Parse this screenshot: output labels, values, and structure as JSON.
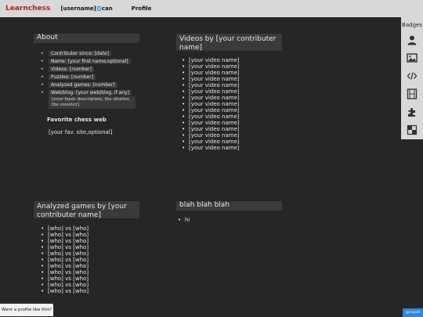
{
  "nav": {
    "brand": "Learnchess",
    "user_prefix": "[username]",
    "user_suffix": "can",
    "profile": "Profile"
  },
  "badges": {
    "title": "Badges",
    "items": [
      "user-icon",
      "image-icon",
      "code-icon",
      "film-icon",
      "puzzle-icon",
      "chessboard-icon"
    ]
  },
  "about": {
    "title": "About",
    "items": [
      "Contributer since: [date]",
      "Name: [your first name,optional]",
      "Videos: [number]",
      "Puzzles: [number]",
      "Analyzed games: [number]",
      "Web/blog: [your web/blog, if any]"
    ],
    "description": "[your basic description, the shorter, the sweeter]",
    "fav_title": "Favorite chess web",
    "fav_site": "[your fav. site,optional]"
  },
  "videos": {
    "title": "Videos by [your contributer name]",
    "items": [
      "[your video name]",
      "[your video name]",
      "[your video name]",
      "[your video name]",
      "[your video name]",
      "[your video name]",
      "[your video name]",
      "[your video name]",
      "[your video name]",
      "[your video name]",
      "[your video name]",
      "[your video name]",
      "[your video name]",
      "[your video name]",
      "[your video name]"
    ]
  },
  "games": {
    "title": "Analyzed games by [your contributer name]",
    "items": [
      "[who] vs [who]",
      "[who] vs [who]",
      "[who] vs [who]",
      "[who] vs [who]",
      "[who] vs [who]",
      "[who] vs [who]",
      "[who] vs [who]",
      "[who] vs [who]",
      "[who] vs [who]",
      "[who] vs [who]",
      "[who] vs [who]"
    ]
  },
  "blah": {
    "title": "blah blah blah",
    "items": [
      "hi"
    ]
  },
  "footer": {
    "want_profile": "Want a profile like this?",
    "corner_button": "go back"
  },
  "colors": {
    "background": "#262626",
    "brand": "#b22222",
    "bar": "#d8d8d8",
    "panel_header": "#3a3a3a",
    "accent_button": "#2e86de"
  }
}
